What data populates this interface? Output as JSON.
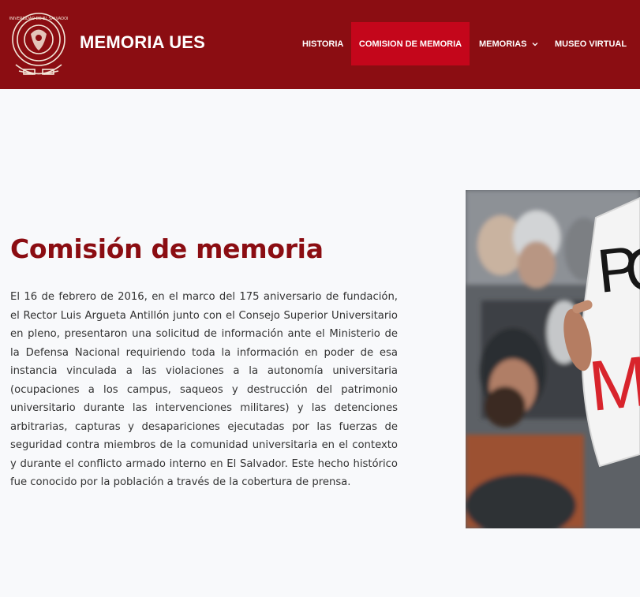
{
  "header": {
    "brand": "MEMORIA UES",
    "logo_icon": "university-seal-icon",
    "background_color": "#8b0d12",
    "nav": {
      "historia": "HISTORIA",
      "comision": "COMISION DE MEMORIA",
      "memorias": "MEMORIAS",
      "museo": "MUSEO VIRTUAL"
    },
    "active_color": "#c4061b"
  },
  "main": {
    "title": "Comisión de memoria",
    "paragraph": "El 16 de febrero de 2016, en el marco del 175 aniversario de fundación, el Rector Luis Argueta Antillón junto con el Consejo Superior Universitario en pleno, presentaron una solicitud de información ante el Ministerio de la Defensa Nacional requiriendo toda la información en poder de esa instancia vinculada a las violaciones a la autonomía universitaria (ocupaciones a los campus, saqueos y destrucción del patrimonio  universitario durante las intervenciones militares) y las detenciones arbitrarias, capturas y desapariciones ejecutadas por las fuerzas de seguridad contra miembros de la comunidad universitaria en el contexto y durante el conflicto armado interno en El Salvador. Este hecho histórico fue conocido por la población a través de la cobertura de prensa.",
    "title_color": "#8b0d12",
    "photo_sign_text": "PO ME"
  }
}
